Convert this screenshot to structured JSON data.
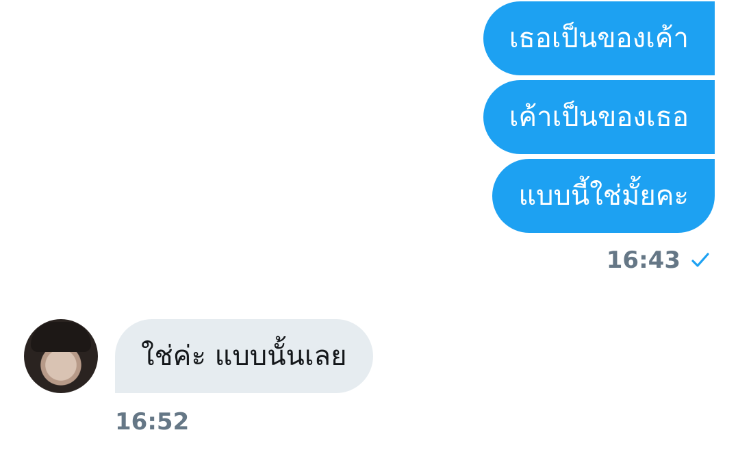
{
  "messages_out": [
    {
      "text": "เธอเป็นของเค้า"
    },
    {
      "text": "เค้าเป็นของเธอ"
    },
    {
      "text": "แบบนี้ใช่มั้ยคะ"
    }
  ],
  "out_meta": {
    "time": "16:43",
    "status_icon": "check-icon",
    "status_color": "#1da1f2"
  },
  "message_in": {
    "text": "ใช่ค่ะ แบบนั้นเลย",
    "time": "16:52",
    "avatar_icon": "avatar"
  },
  "colors": {
    "outgoing_bubble": "#1da1f2",
    "incoming_bubble": "#e6ecf0",
    "time_text": "#657786"
  }
}
